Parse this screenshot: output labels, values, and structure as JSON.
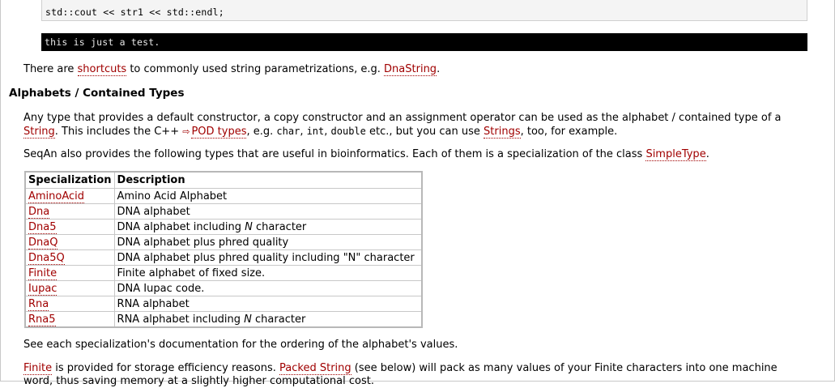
{
  "code_snippet": "std::cout << str1 << std::endl;",
  "output_snippet": "this is just a test.",
  "shortcuts_para": {
    "prefix": "There are ",
    "link1": "shortcuts",
    "middle": " to commonly used string parametrizations, e.g. ",
    "link2": "DnaString",
    "suffix": "."
  },
  "section_heading": "Alphabets / Contained Types",
  "alphabet_para": {
    "part1": "Any type that provides a default constructor, a copy constructor and an assignment operator can be used as the alphabet / contained type of a ",
    "link_string": "String",
    "part2": ". This includes the C++ ",
    "ext_icon": "⇨",
    "link_pod": "POD types",
    "part3": ", e.g. ",
    "code_char": "char",
    "sep1": ", ",
    "code_int": "int",
    "sep2": ", ",
    "code_double": "double",
    "part4": " etc., but you can use ",
    "link_strings": "Strings",
    "part5": ", too, for example."
  },
  "seqan_para": {
    "text": "SeqAn also provides the following types that are useful in bioinformatics. Each of them is a specialization of the class ",
    "link": "SimpleType",
    "suffix": "."
  },
  "table": {
    "headers": [
      "Specialization",
      "Description"
    ],
    "rows": [
      {
        "spec": "AminoAcid",
        "desc": "Amino Acid Alphabet"
      },
      {
        "spec": "Dna",
        "desc": "DNA alphabet"
      },
      {
        "spec": "Dna5",
        "desc_pre": "DNA alphabet including ",
        "desc_em": "N",
        "desc_post": " character"
      },
      {
        "spec": "DnaQ",
        "desc": "DNA alphabet plus phred quality"
      },
      {
        "spec": "Dna5Q",
        "desc": "DNA alphabet plus phred quality including \"N\" character"
      },
      {
        "spec": "Finite",
        "desc": "Finite alphabet of fixed size."
      },
      {
        "spec": "Iupac",
        "desc": "DNA Iupac code."
      },
      {
        "spec": "Rna",
        "desc": "RNA alphabet"
      },
      {
        "spec": "Rna5",
        "desc_pre": "RNA alphabet including ",
        "desc_em": "N",
        "desc_post": " character"
      }
    ]
  },
  "ordering_para": "See each specialization's documentation for the ordering of the alphabet's values.",
  "finite_para": {
    "link_finite": "Finite",
    "part1": " is provided for storage efficiency reasons. ",
    "link_packed": "Packed String",
    "part2": " (see below) will pack as many values of your Finite characters into one machine word, thus saving memory at a slightly higher computational cost."
  }
}
